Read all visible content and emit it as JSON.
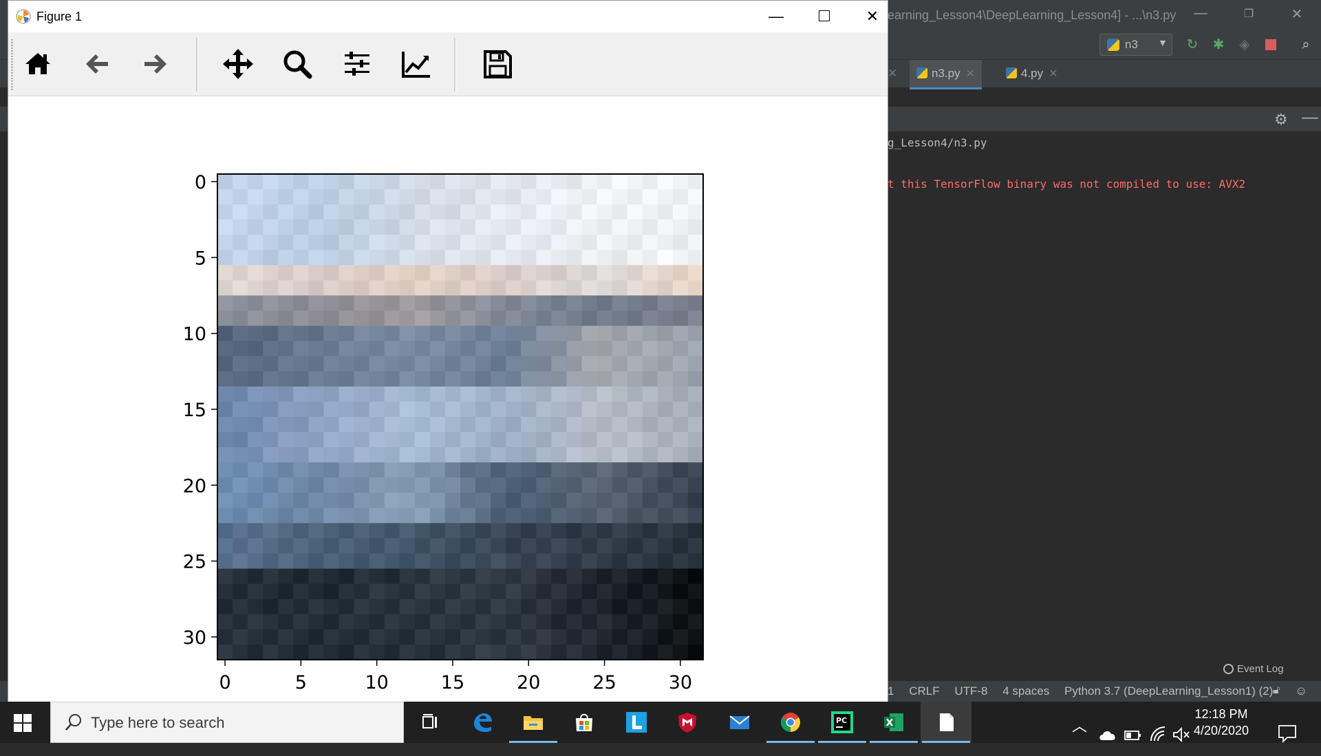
{
  "ide": {
    "title": "earning_Lesson4\\DeepLearning_Lesson4] - ...\\n3.py",
    "run_config": "n3",
    "tabs": [
      {
        "label": "n3.py",
        "active": true
      },
      {
        "label": "4.py",
        "active": false
      }
    ],
    "console": {
      "path_line": "g_Lesson4/n3.py",
      "warning_line": "t this TensorFlow binary was not compiled to use: AVX2"
    },
    "event_log": "Event Log",
    "status": {
      "line_col": "1",
      "line_sep": "CRLF",
      "encoding": "UTF-8",
      "indent": "4 spaces",
      "interpreter": "Python 3.7 (DeepLearning_Lesson1) (2)"
    }
  },
  "figure": {
    "window_title": "Figure 1",
    "toolbar": [
      "home-icon",
      "back-arrow-icon",
      "forward-arrow-icon",
      "pan-move-icon",
      "zoom-magnifier-icon",
      "configure-subplots-icon",
      "edit-axes-icon",
      "save-floppy-icon"
    ]
  },
  "chart_data": {
    "type": "heatmap",
    "title": "",
    "xlabel": "",
    "ylabel": "",
    "xlim": [
      -0.5,
      31.5
    ],
    "ylim": [
      31.5,
      -0.5
    ],
    "x_ticks": [
      "0",
      "5",
      "10",
      "15",
      "20",
      "25",
      "30"
    ],
    "y_ticks": [
      "0",
      "5",
      "10",
      "15",
      "20",
      "25",
      "30"
    ],
    "grid": false,
    "rows": 32,
    "cols": 32,
    "row_bands": [
      {
        "rows": [
          0,
          6
        ],
        "colors": [
          "#c6d5ea",
          "#b9cde3",
          "#d2dbe6",
          "#e4e8ef",
          "#eef1f4",
          "#f0f1f2"
        ]
      },
      {
        "rows": [
          6,
          8
        ],
        "colors": [
          "#dcd5d0",
          "#d7c9c6",
          "#e2d0c4",
          "#dccfc9",
          "#d9d6d6",
          "#e6d2c4"
        ]
      },
      {
        "rows": [
          8,
          10
        ],
        "colors": [
          "#8a8f99",
          "#8f8e97",
          "#a09b9e",
          "#7f8795",
          "#6f7a8a",
          "#7d8290"
        ]
      },
      {
        "rows": [
          10,
          14
        ],
        "colors": [
          "#56657b",
          "#6a7a8e",
          "#7b8aa0",
          "#6d7f97",
          "#a5a8ad",
          "#9aa3ad"
        ]
      },
      {
        "rows": [
          14,
          19
        ],
        "colors": [
          "#6d87ad",
          "#8fa3c4",
          "#a7bcd6",
          "#9daec4",
          "#b6bec8",
          "#a5adb7"
        ]
      },
      {
        "rows": [
          19,
          23
        ],
        "colors": [
          "#6f8fb2",
          "#6f88a6",
          "#8aa1ba",
          "#4a5c72",
          "#5a6675",
          "#3a4452"
        ]
      },
      {
        "rows": [
          23,
          26
        ],
        "colors": [
          "#5a7290",
          "#4a6078",
          "#44586a",
          "#3a4656",
          "#2e3a46",
          "#27323d"
        ]
      },
      {
        "rows": [
          26,
          32
        ],
        "colors": [
          "#26313b",
          "#222c35",
          "#28343d",
          "#303a44",
          "#1e262e",
          "#0e1214"
        ]
      }
    ]
  },
  "taskbar": {
    "search_placeholder": "Type here to search",
    "apps": [
      "task-view-icon",
      "edge-icon",
      "file-explorer-icon",
      "store-icon",
      "l-app-icon",
      "mcafee-icon",
      "mail-icon",
      "chrome-icon",
      "pycharm-icon",
      "excel-icon",
      "notepad-icon"
    ],
    "time": "12:18 PM",
    "date": "4/20/2020"
  },
  "colors": {
    "ide_bg": "#2b2b2b",
    "ide_panel": "#3c3f41",
    "warning": "#ff6b68",
    "taskbar": "#202020"
  }
}
